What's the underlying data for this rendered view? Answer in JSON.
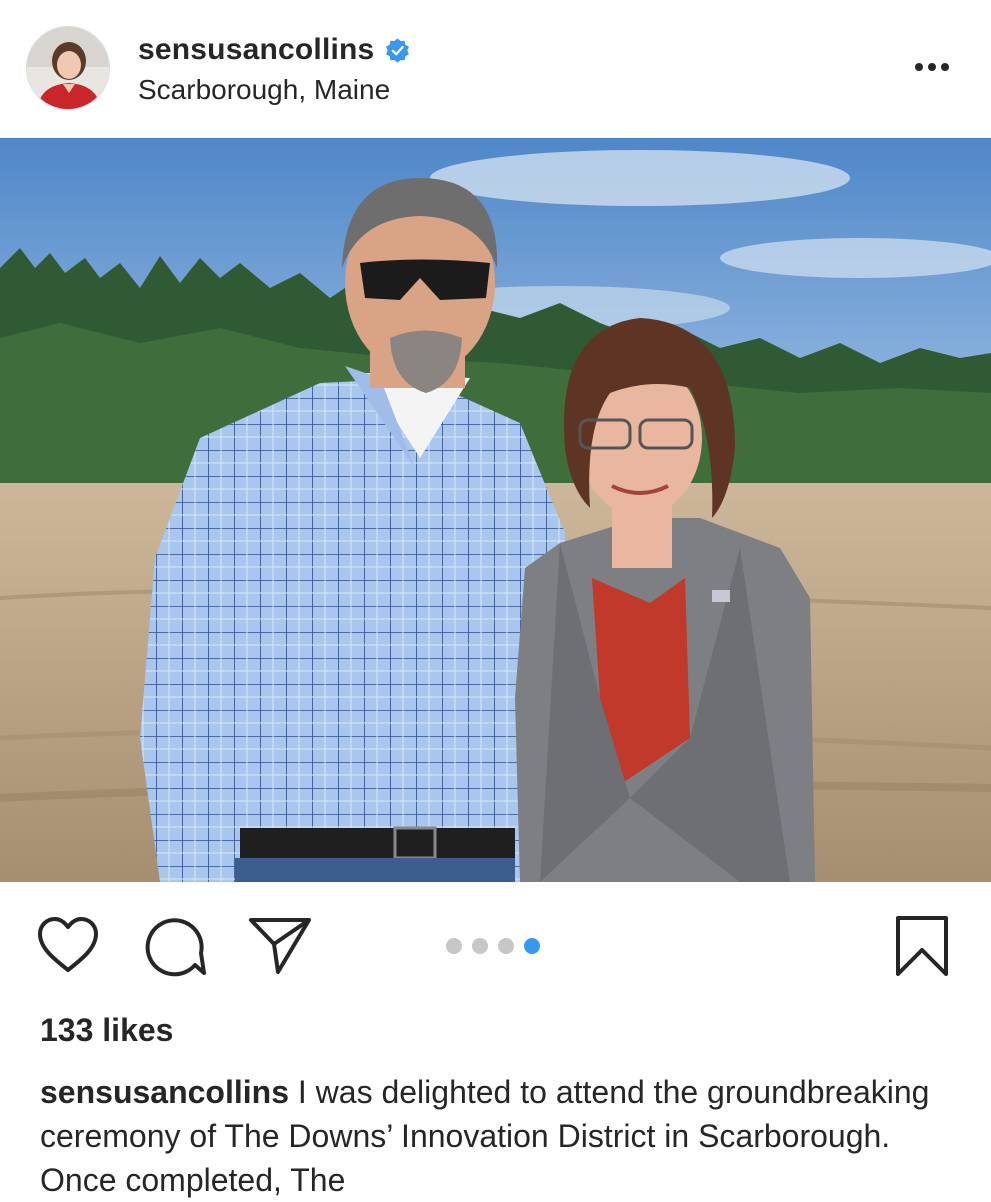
{
  "post": {
    "username": "sensusancollins",
    "verified": true,
    "location": "Scarborough, Maine",
    "more_icon": "more-horizontal-icon",
    "photo_alt": "Two people standing in front of a cleared dirt field with pine trees and blue sky",
    "carousel": {
      "total": 4,
      "active_index": 3
    },
    "actions": {
      "like_icon": "heart-icon",
      "comment_icon": "comment-icon",
      "share_icon": "paper-plane-icon",
      "save_icon": "bookmark-icon"
    },
    "likes_text": "133 likes",
    "caption": {
      "user": "sensusancollins",
      "text": " I was delighted to attend the groundbreaking ceremony of The Downs’ Innovation District in Scarborough.  Once completed, The"
    }
  },
  "colors": {
    "verified_blue": "#3897f0",
    "active_dot": "#3897f0",
    "inactive_dot": "#c7c7c7",
    "text": "#262626"
  }
}
